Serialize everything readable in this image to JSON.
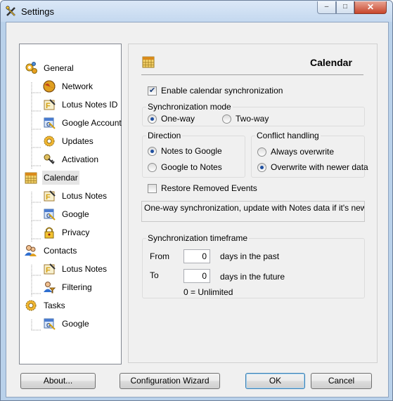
{
  "window": {
    "title": "Settings",
    "controls": {
      "minimize": "–",
      "maximize": "□",
      "close": "✕"
    }
  },
  "tree": {
    "items": [
      {
        "label": "General",
        "icon": "gears-icon",
        "level": 0
      },
      {
        "label": "Network",
        "icon": "globe-icon",
        "level": 1
      },
      {
        "label": "Lotus Notes ID",
        "icon": "lotus-notes-icon",
        "level": 1
      },
      {
        "label": "Google Account",
        "icon": "google-calendar-icon",
        "level": 1
      },
      {
        "label": "Updates",
        "icon": "updates-gear-icon",
        "level": 1
      },
      {
        "label": "Activation",
        "icon": "key-icon",
        "level": 1
      },
      {
        "label": "Calendar",
        "icon": "calendar-icon",
        "level": 0,
        "selected": true
      },
      {
        "label": "Lotus Notes",
        "icon": "lotus-notes-icon",
        "level": 1
      },
      {
        "label": "Google",
        "icon": "google-calendar-icon",
        "level": 1
      },
      {
        "label": "Privacy",
        "icon": "padlock-icon",
        "level": 1
      },
      {
        "label": "Contacts",
        "icon": "contacts-icon",
        "level": 0
      },
      {
        "label": "Lotus Notes",
        "icon": "lotus-notes-icon",
        "level": 1
      },
      {
        "label": "Filtering",
        "icon": "contacts-filter-icon",
        "level": 1
      },
      {
        "label": "Tasks",
        "icon": "tasks-gear-icon",
        "level": 0
      },
      {
        "label": "Google",
        "icon": "google-calendar-icon",
        "level": 1
      }
    ]
  },
  "panel": {
    "title": "Calendar",
    "enable_sync": {
      "label": "Enable calendar synchronization",
      "checked": true
    },
    "sync_mode": {
      "title": "Synchronization mode",
      "options": [
        {
          "label": "One-way",
          "selected": true
        },
        {
          "label": "Two-way",
          "selected": false
        }
      ]
    },
    "direction": {
      "title": "Direction",
      "options": [
        {
          "label": "Notes to Google",
          "selected": true
        },
        {
          "label": "Google to Notes",
          "selected": false
        }
      ]
    },
    "conflict": {
      "title": "Conflict handling",
      "options": [
        {
          "label": "Always overwrite",
          "selected": false
        },
        {
          "label": "Overwrite with newer data",
          "selected": true
        }
      ]
    },
    "restore": {
      "label": "Restore Removed Events",
      "checked": false
    },
    "description": "One-way synchronization, update with Notes data if it's newer",
    "timeframe": {
      "title": "Synchronization timeframe",
      "from_label": "From",
      "from_value": "0",
      "from_suffix": "days in the past",
      "to_label": "To",
      "to_value": "0",
      "to_suffix": "days in the future",
      "note": "0 = Unlimited"
    }
  },
  "buttons": {
    "about": "About...",
    "wizard": "Configuration Wizard",
    "ok": "OK",
    "cancel": "Cancel"
  },
  "colors": {
    "window_frame": "#b9d1ea",
    "selection": "#e5e5e5",
    "radio_dot": "#1e4fa0",
    "close_button": "#c8462c"
  }
}
